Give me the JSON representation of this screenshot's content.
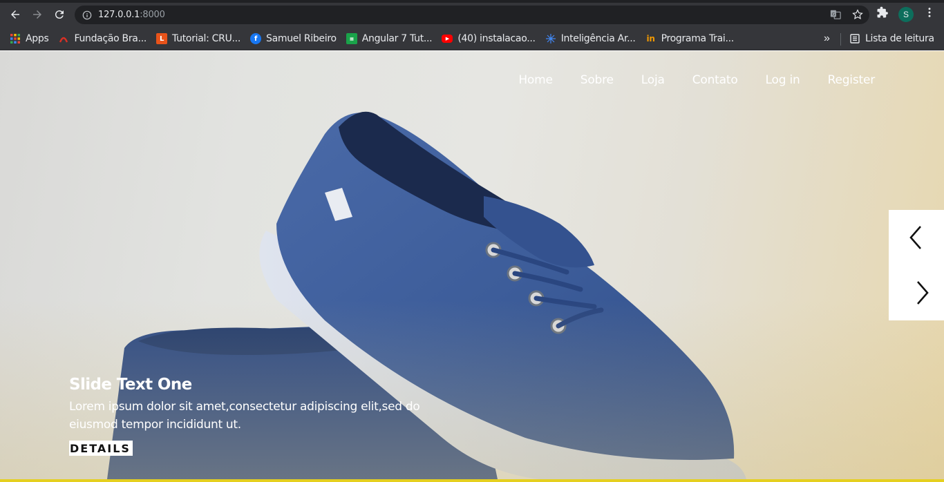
{
  "browser": {
    "url_host": "127.0.0.1",
    "url_port": ":8000",
    "profile_initial": "S",
    "bookmarks": [
      {
        "label": "Apps",
        "icon": "apps-grid-icon",
        "color": "#ea4335"
      },
      {
        "label": "Fundação Bra...",
        "icon": "fundacao-icon",
        "color": "#d93025"
      },
      {
        "label": "Tutorial: CRU...",
        "icon": "tutorial-l-icon",
        "color": "#e8531a"
      },
      {
        "label": "Samuel Ribeiro",
        "icon": "facebook-icon",
        "color": "#1877f2"
      },
      {
        "label": "Angular 7 Tut...",
        "icon": "angular-site-icon",
        "color": "#1aa34a"
      },
      {
        "label": "(40) instalacao...",
        "icon": "youtube-icon",
        "color": "#ff0000"
      },
      {
        "label": "Inteligência Ar...",
        "icon": "ia-icon",
        "color": "#34a853"
      },
      {
        "label": "Programa Trai...",
        "icon": "programa-icon",
        "color": "#f29900"
      }
    ],
    "overflow_label": "»",
    "reading_list_label": "Lista de leitura"
  },
  "nav": {
    "items": [
      "Home",
      "Sobre",
      "Loja",
      "Contato",
      "Log in",
      "Register"
    ]
  },
  "slide": {
    "title": "Slide Text One",
    "text": "Lorem ipsum dolor sit amet,consectetur adipiscing elit,sed do eiusmod tempor incididunt ut.",
    "button": "DETAILS"
  },
  "colors": {
    "accent_bar": "#e5cf1f",
    "shoe": "#3f5f9c"
  }
}
